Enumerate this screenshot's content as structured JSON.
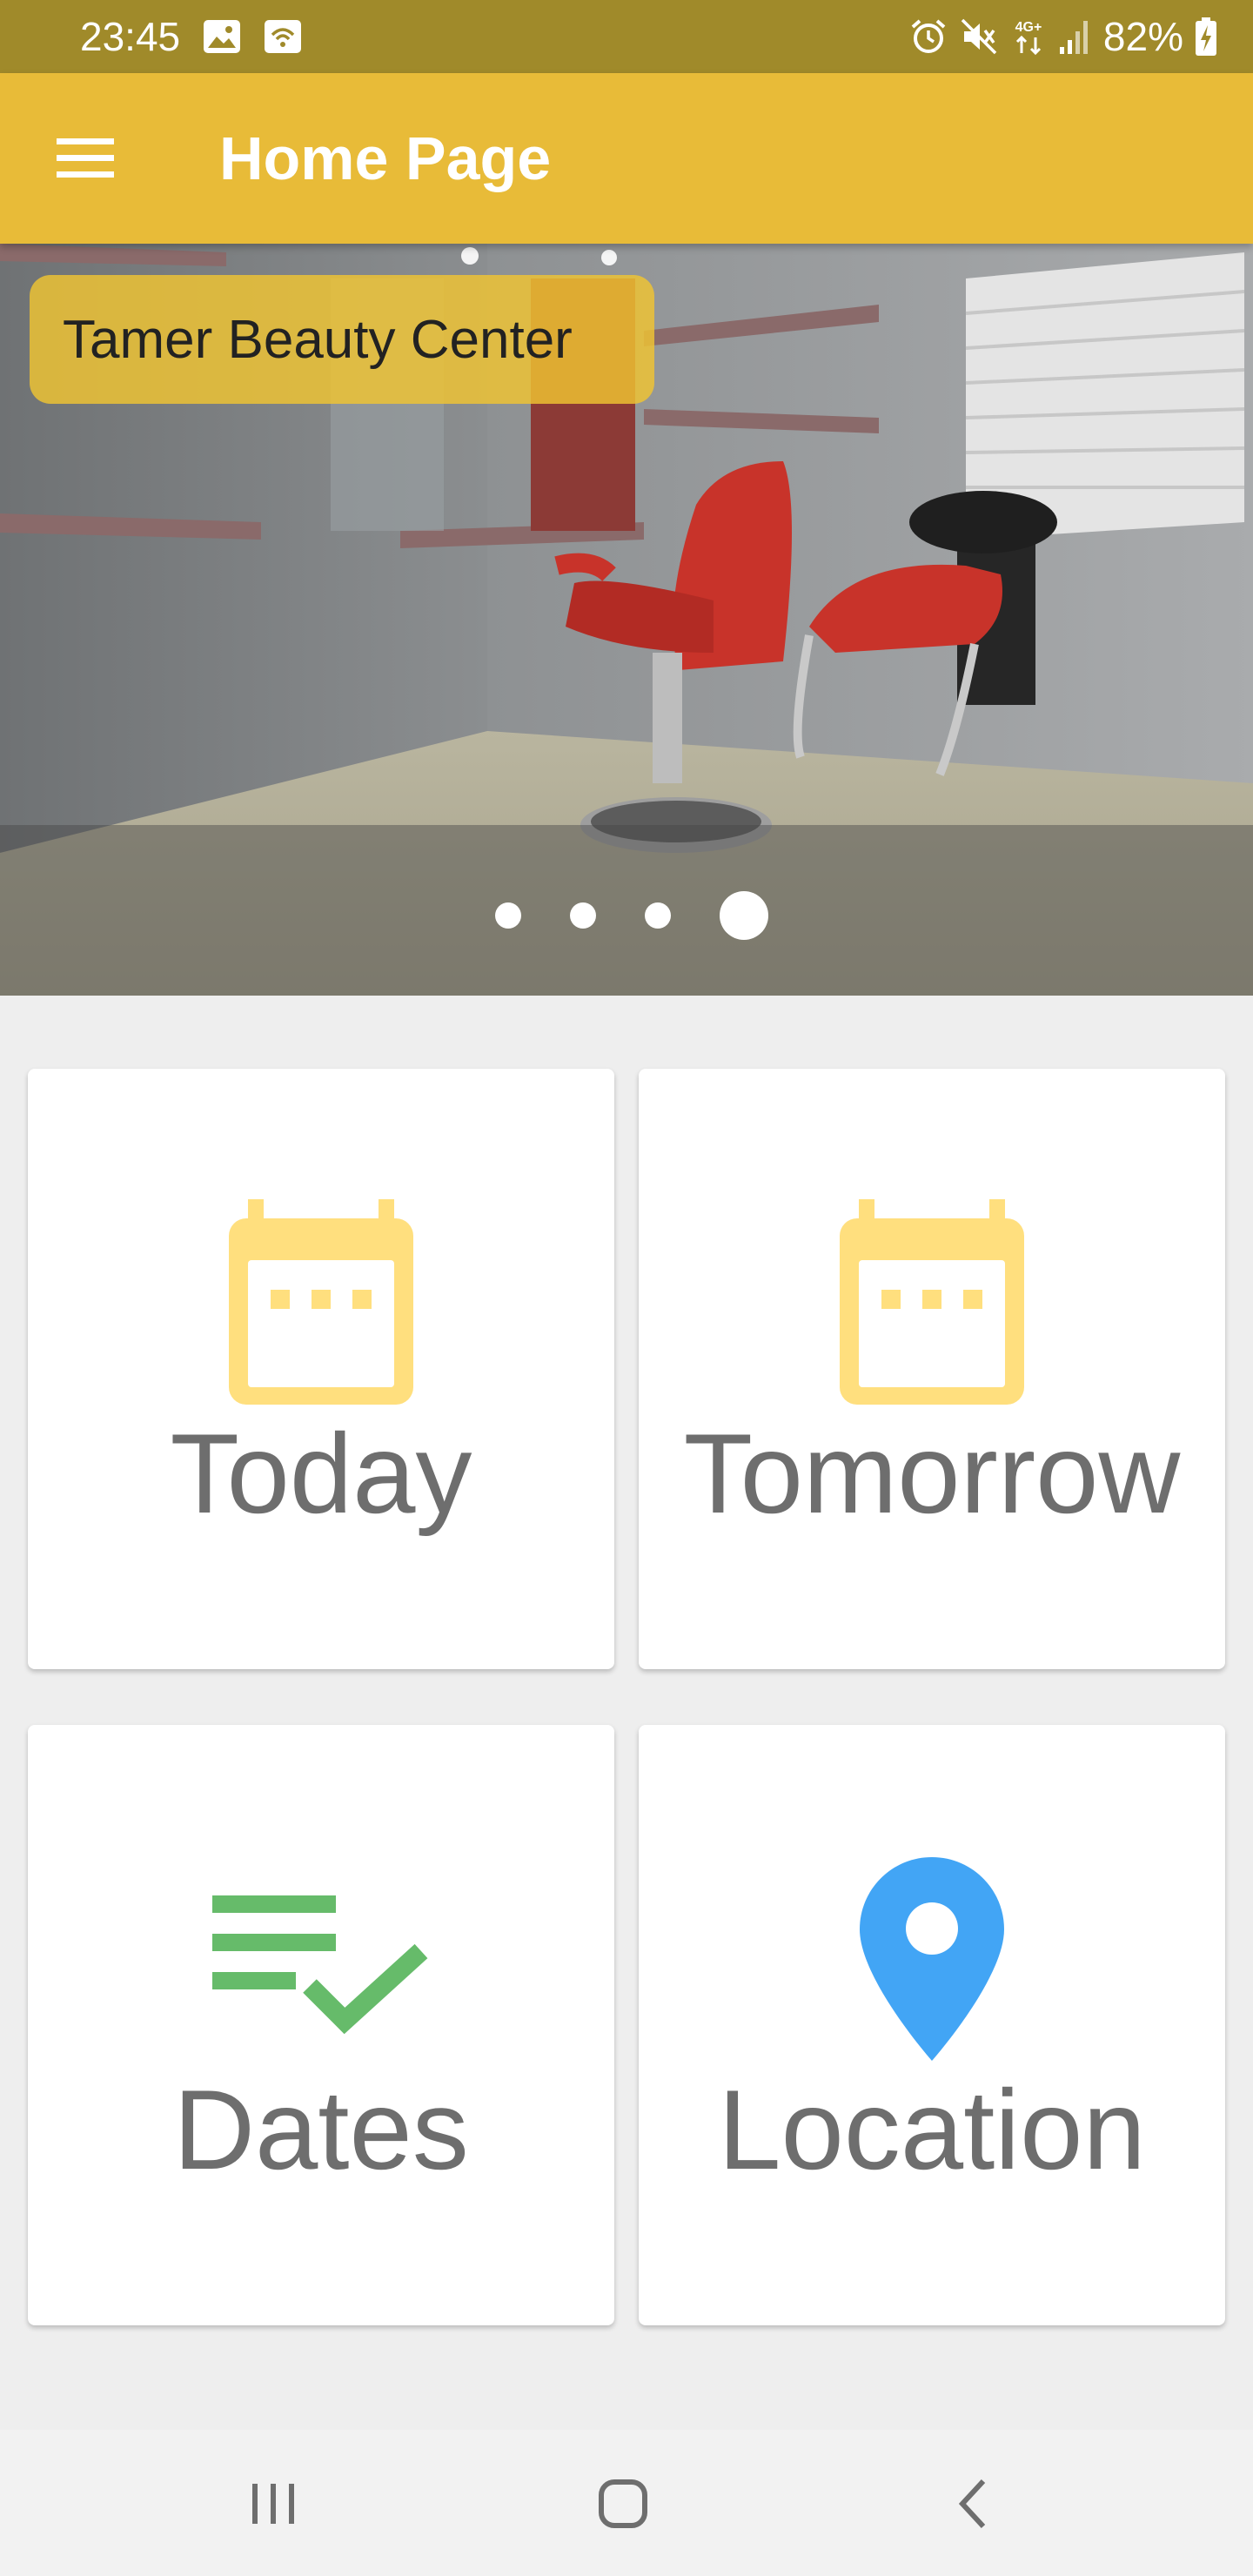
{
  "status_bar": {
    "time": "23:45",
    "battery": "82%",
    "network": "4G+"
  },
  "app_bar": {
    "title": "Home Page",
    "menu_icon": "hamburger-menu-icon"
  },
  "banner": {
    "caption": "Tamer Beauty Center",
    "slide_count": 4,
    "active_slide": 4
  },
  "tiles": [
    {
      "label": "Today",
      "icon": "calendar-icon",
      "color": "#ffdf7e"
    },
    {
      "label": "Tomorrow",
      "icon": "calendar-icon",
      "color": "#ffdf7e"
    },
    {
      "label": "Dates",
      "icon": "list-check-icon",
      "color": "#66bb6a"
    },
    {
      "label": "Location",
      "icon": "location-pin-icon",
      "color": "#42a5f5"
    }
  ],
  "colors": {
    "primary": "#e8bb38",
    "status_bar": "#a08a2a",
    "text_gray": "#6e6e6e"
  },
  "nav_bar": {
    "recents_icon": "recents-icon",
    "home_icon": "home-icon",
    "back_icon": "back-icon"
  }
}
